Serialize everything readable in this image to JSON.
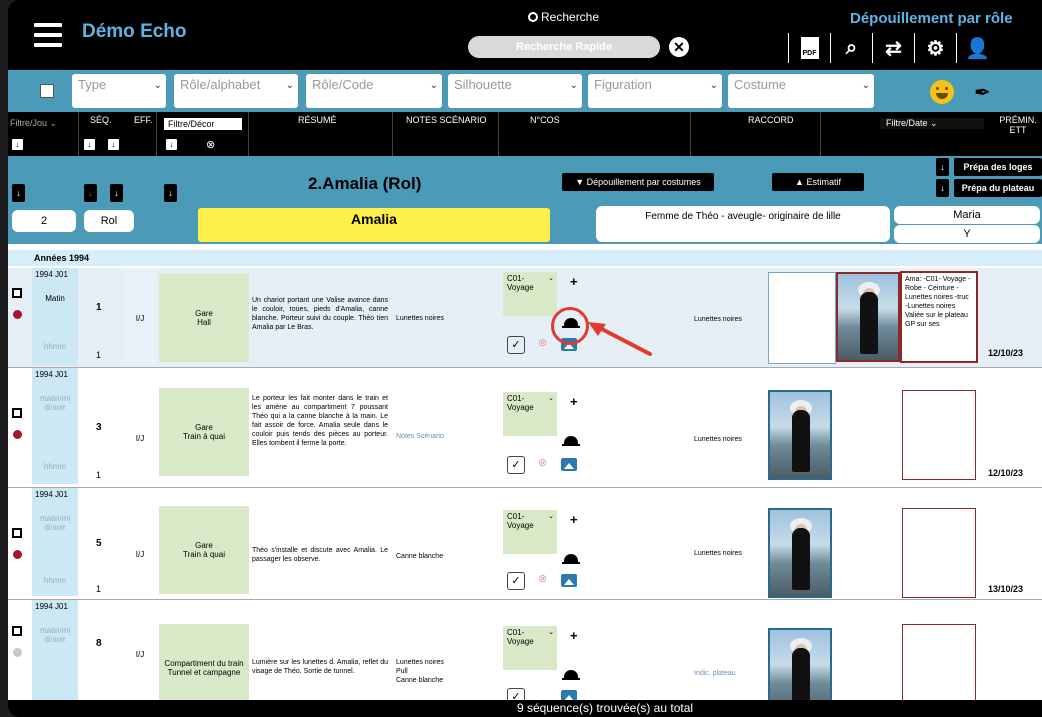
{
  "app": {
    "title": "Démo Echo",
    "right_title": "Dépouillement par rôle"
  },
  "search": {
    "label": "Recherche",
    "placeholder": "Recherche Rapide"
  },
  "toolbar": {
    "pdf_label": "PDF"
  },
  "filters": {
    "type": "Type",
    "role_alpha": "Rôle/alphabet",
    "role_code": "Rôle/Code",
    "silhouette": "Silhouette",
    "figuration": "Figuration",
    "costume": "Costume"
  },
  "columns": {
    "filtre_jour": "Filtre/Jou",
    "seq": "SÉQ.",
    "eff": "EFF.",
    "filtre_decor": "Filtre/Décor",
    "resume": "RÉSUMÉ",
    "notes_scenario": "NOTES SCÉNARIO",
    "ncos": "N°COS",
    "raccord": "RACCORD",
    "filtre_date": "Filtre/Date",
    "premin": "PRÉMIN. ETT"
  },
  "role": {
    "title": "2.Amalia    (Rol)",
    "btn_costumes": "▼ Dépouillement par costumes",
    "btn_estimatif": "▲ Estimatif",
    "btn_loges": "Prépa des loges",
    "btn_plateau": "Prépa du plateau",
    "number": "2",
    "code": "Rol",
    "name": "Amalia",
    "description": "Femme de Théo - aveugle- originaire de lille",
    "actor": "Maria",
    "actor_sub": "Y"
  },
  "year_label": "Années 1994",
  "rows": [
    {
      "date": "1994 J01",
      "time": "Matin",
      "hhmm": "hhmm",
      "seq": "1",
      "eff_count": "1",
      "ij": "I/J",
      "decor": "Gare\nHall",
      "resume": "Un chariot portant une Valise avance dans le couloir, roues, pieds d'Amalia, canne blanche. Porteur suivi du couple. Théo tien Amalia par Le Bras.",
      "notes": "Lunettes noires",
      "cos": "C01- Voyage",
      "raccord": "Lunettes noires",
      "note_box": "Ama: -C01- Voyage -Robe - Ceinture - Lunettes noires -truc -Lunettes noires Valiée sur le plateau GP sur ses",
      "date_end": "12/10/23",
      "dot_color": "#a0182a"
    },
    {
      "date": "1994 J01",
      "time": "matin/mi di/soir",
      "hhmm": "hhmm",
      "seq": "3",
      "eff_count": "1",
      "ij": "I/J",
      "decor": "Gare\nTrain à quai",
      "resume": "Le porteur les fait monter dans le train et les amène au compartiment 7 poussant Théo qui a la canne blanche à la main. Le fait assoir de force. Amalia seule dans le couloir puis tends des pièces au porteur. Elles tombent il ferme la porte.",
      "notes": "Notes Scénario",
      "cos": "C01- Voyage",
      "raccord": "Lunettes noires",
      "date_end": "12/10/23",
      "dot_color": "#a0182a"
    },
    {
      "date": "1994 J01",
      "time": "matin/mi di/soir",
      "hhmm": "hhmm",
      "seq": "5",
      "eff_count": "1",
      "ij": "I/J",
      "decor": "Gare\nTrain à quai",
      "resume": "Théo s'installe et discute avec Amalia. Le passager les observe.",
      "notes": "Canne blanche",
      "cos": "C01- Voyage",
      "raccord": "Lunettes noires",
      "date_end": "13/10/23",
      "dot_color": "#a0182a"
    },
    {
      "date": "1994 J01",
      "time": "matin/mi di/soir",
      "seq": "8",
      "ij": "I/J",
      "decor": "Compartiment du train\nTunnel et campagne",
      "resume": "Lumière sur les lunettes d. Amalia, reflet du visage de Théo. Sortie de tunnel.",
      "notes": "Lunettes noires\nPull\nCanne blanche",
      "cos": "C01- Voyage",
      "raccord": "Indic. plateau",
      "dot_color": "#c8c8c8"
    }
  ],
  "status": "9 séquence(s) trouvée(s) au total"
}
